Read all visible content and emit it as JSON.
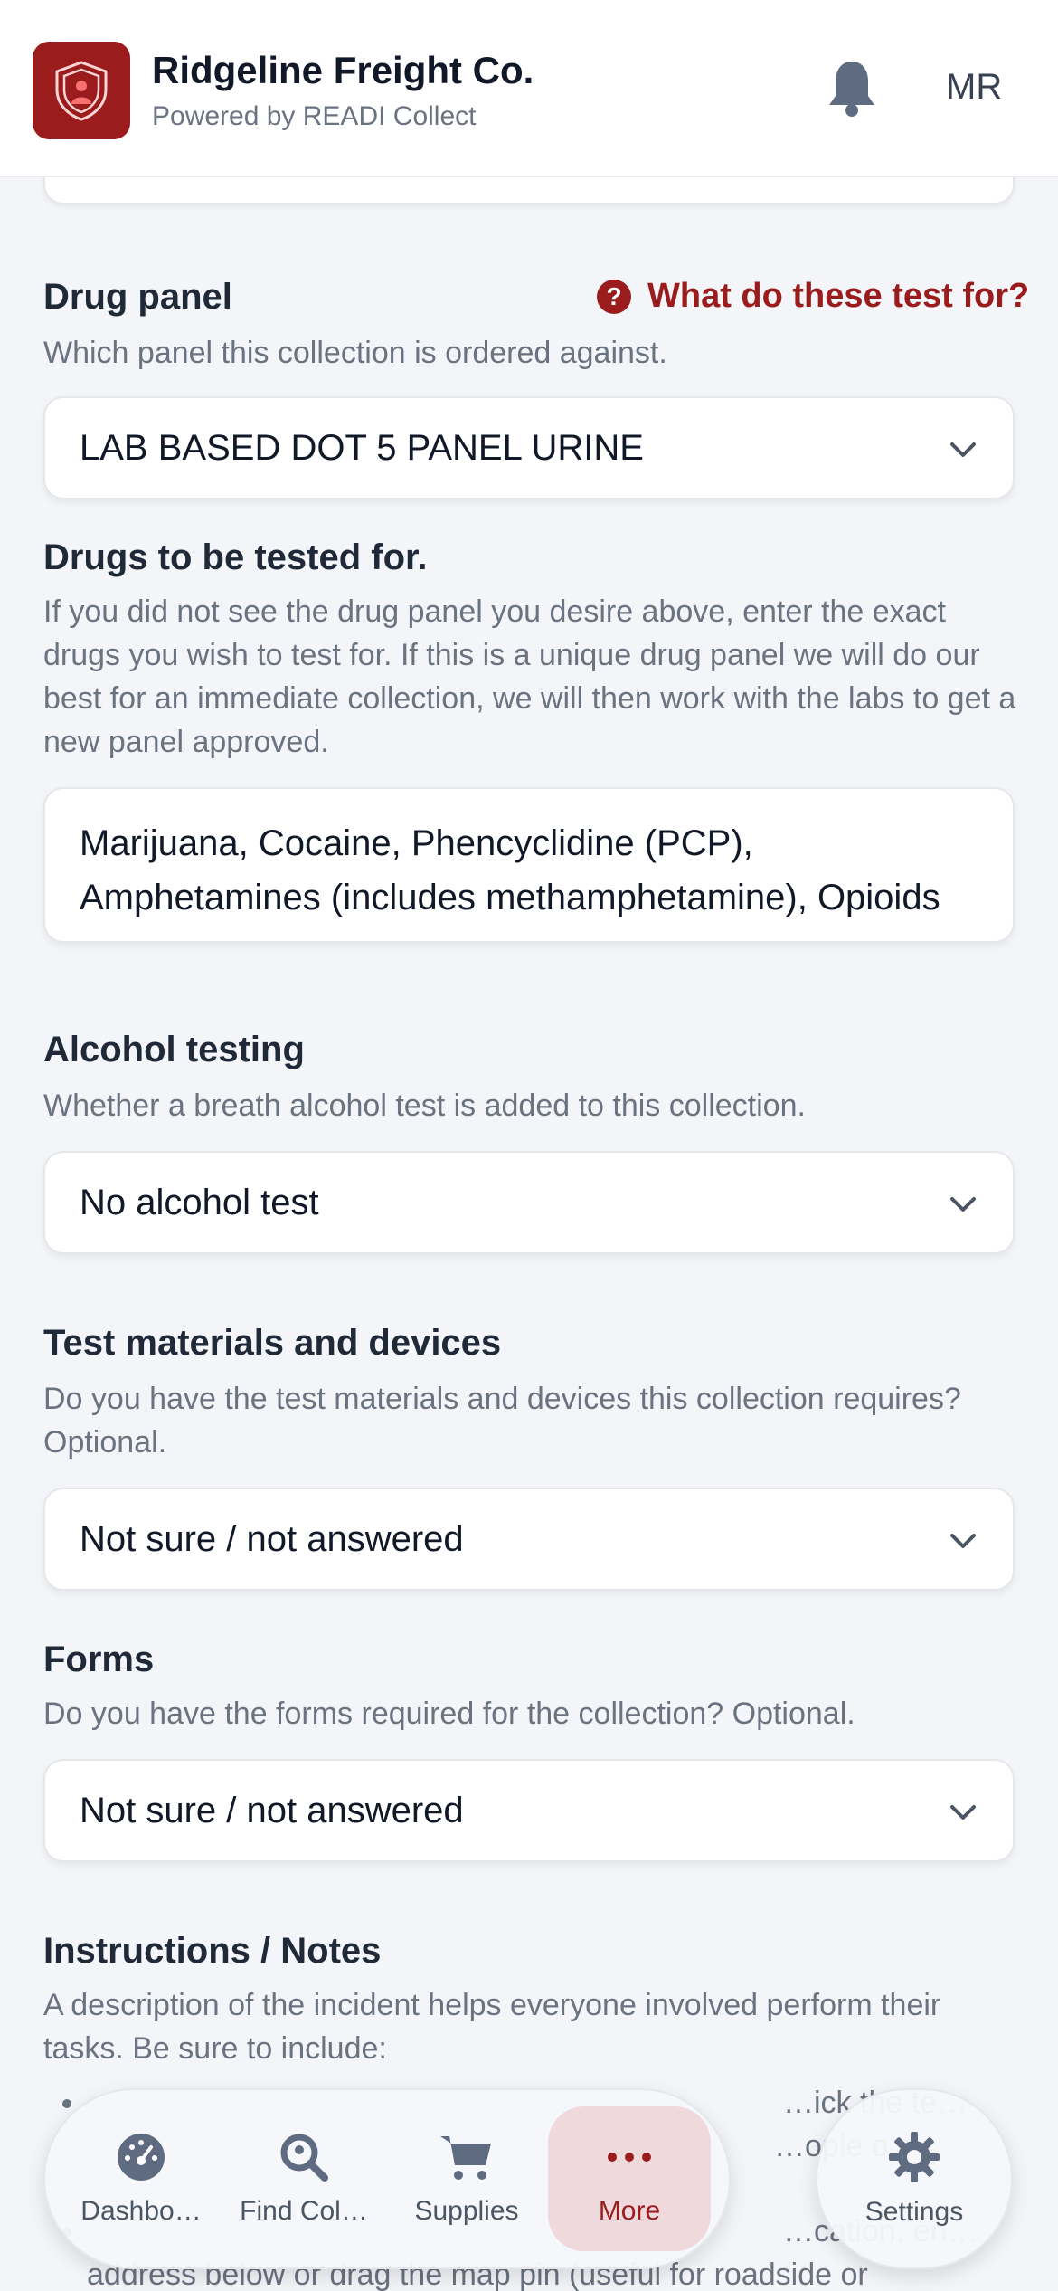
{
  "header": {
    "company": "Ridgeline Freight Co.",
    "subtitle": "Powered by READI Collect",
    "avatar_initials": "MR"
  },
  "drug_panel": {
    "label": "Drug panel",
    "help_link": "What do these test for?",
    "description": "Which panel this collection is ordered against.",
    "selected": "LAB BASED DOT 5 PANEL URINE"
  },
  "drugs_tested": {
    "label": "Drugs to be tested for.",
    "description": "If you did not see the drug panel you desire above, enter the exact drugs you wish to test for. If this is a unique drug panel we will do our best for an immediate collection, we will then work with the labs to get a new panel approved.",
    "value": "Marijuana, Cocaine, Phencyclidine (PCP), Amphetamines (includes methamphetamine), Opioids"
  },
  "alcohol": {
    "label": "Alcohol testing",
    "description": "Whether a breath alcohol test is added to this collection.",
    "selected": "No alcohol test"
  },
  "materials": {
    "label": "Test materials and devices",
    "description": "Do you have the test materials and devices this collection requires? Optional.",
    "selected": "Not sure / not answered"
  },
  "forms": {
    "label": "Forms",
    "description": "Do you have the forms required for the collection? Optional.",
    "selected": "Not sure / not answered"
  },
  "instructions": {
    "label": "Instructions / Notes",
    "description": "A description of the incident helps everyone involved perform their tasks. Be sure to include:",
    "bullet_1": "…ick the te…",
    "bullet_1b": "…ople o…",
    "bullet_2": "…cation, en…",
    "bullet_2b": "address below or drag the map pin (useful for roadside or"
  },
  "nav": {
    "dashboard": "Dashbo…",
    "find": "Find Col…",
    "supplies": "Supplies",
    "more": "More",
    "settings": "Settings"
  },
  "colors": {
    "brand": "#9b1c1c",
    "background": "#f3f5f9",
    "active_tab_bg": "#f0d9dc"
  }
}
